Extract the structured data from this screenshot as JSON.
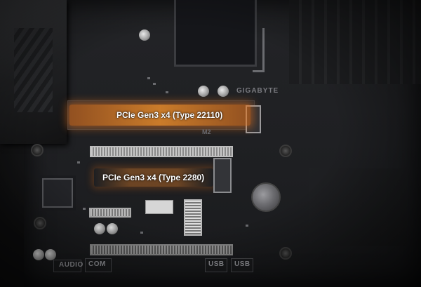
{
  "photo": {
    "brand": "GIGABYTE",
    "silkscreen_label": "M2",
    "m2_slots": [
      {
        "label": "PCIe Gen3 x4 (Type 22110)",
        "highlight_color": "#ff8c28"
      },
      {
        "label": "PCIe Gen3 x4 (Type 2280)",
        "highlight_color": "#ff8c28"
      }
    ],
    "io_labels": {
      "audio": "AUDIO",
      "com": "COM",
      "usb_1": "USB",
      "usb_2": "USB"
    }
  }
}
